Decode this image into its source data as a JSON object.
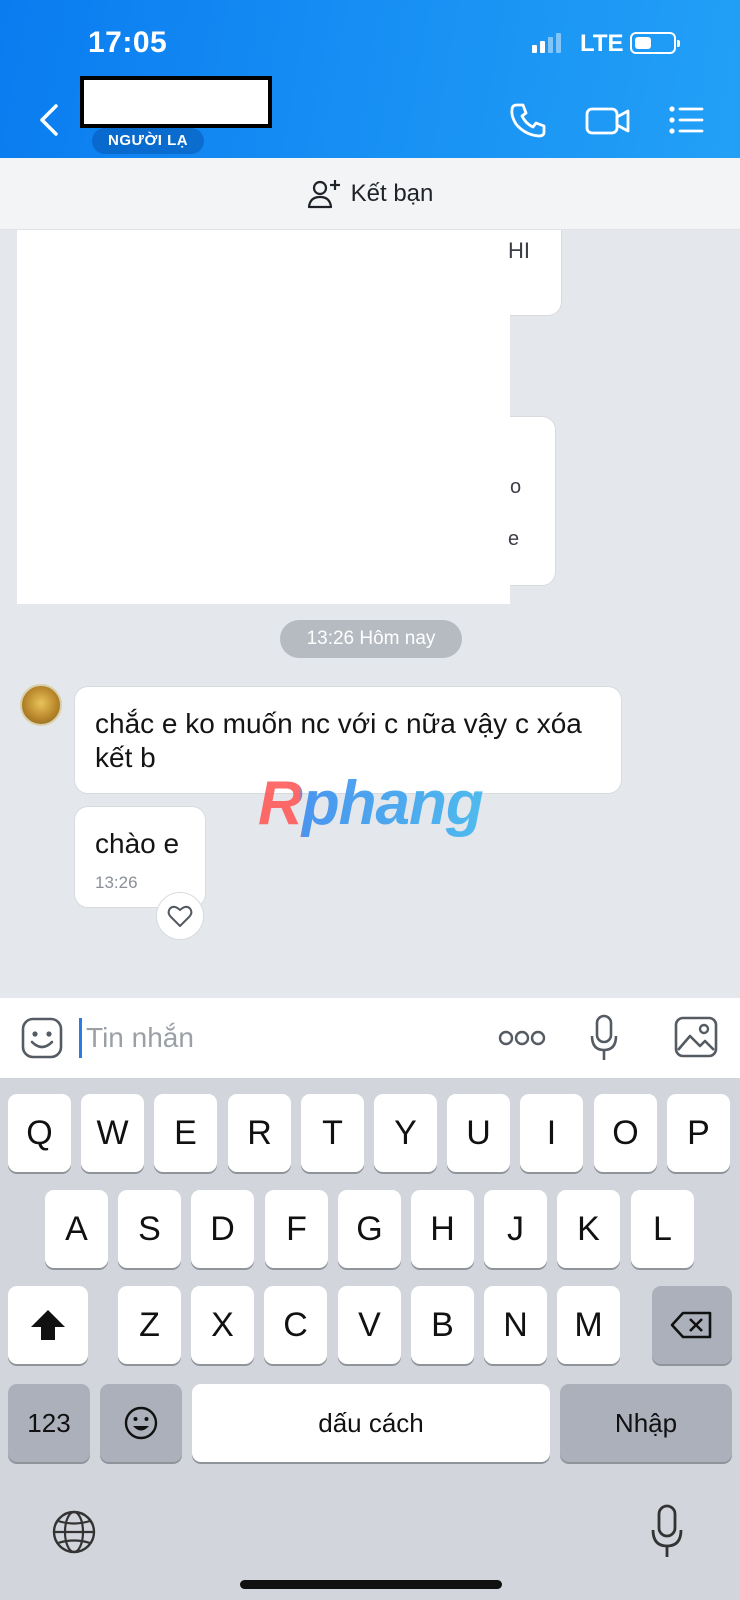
{
  "status_bar": {
    "time": "17:05",
    "network": "LTE"
  },
  "header": {
    "contact_tag": "NGƯỜI LẠ"
  },
  "add_friend_bar": {
    "label": "Kết bạn"
  },
  "obscured_fragments": {
    "a": "HI",
    "b": "o",
    "c": "e"
  },
  "chat": {
    "time_divider": "13:26 Hôm nay",
    "messages": [
      {
        "text": "chắc e ko muốn nc với c nữa vậy c xóa kết b"
      },
      {
        "text": "chào e",
        "time": "13:26"
      }
    ]
  },
  "watermark": "Rphang",
  "input": {
    "placeholder": "Tin nhắn"
  },
  "keyboard": {
    "row1": [
      "Q",
      "W",
      "E",
      "R",
      "T",
      "Y",
      "U",
      "I",
      "O",
      "P"
    ],
    "row2": [
      "A",
      "S",
      "D",
      "F",
      "G",
      "H",
      "J",
      "K",
      "L"
    ],
    "row3": [
      "Z",
      "X",
      "C",
      "V",
      "B",
      "N",
      "M"
    ],
    "numbers_key": "123",
    "space_key": "dấu cách",
    "return_key": "Nhập"
  }
}
